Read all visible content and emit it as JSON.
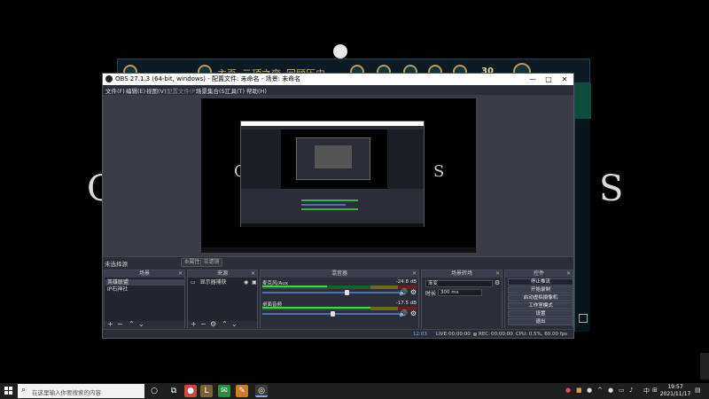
{
  "background": {
    "letter_left": "C",
    "letter_right": "S",
    "game_tabs": [
      "主页",
      "云顶之弈",
      "回顾历史"
    ],
    "game_number": "30"
  },
  "obs": {
    "title": "OBS 27.1.3 (64-bit, windows) - 配置文件: 未命名 - 场景: 未命名",
    "window_buttons": [
      "—",
      "□",
      "✕"
    ],
    "menu": [
      "文件(F)",
      "编辑(E)",
      "视图(V)",
      "配置文件(P)",
      "场景集合(S)",
      "工具(T)",
      "帮助(H)"
    ],
    "preview": {
      "letter_left": "C",
      "letter_right": "S"
    },
    "scene_bar": {
      "source_name": "未选择源",
      "properties_button": "⚙属性",
      "filters_button": "☰滤镜"
    },
    "scenes": {
      "title": "场景",
      "items": [
        "英雄联盟",
        "IP石神社"
      ]
    },
    "sources": {
      "title": "来源",
      "items": [
        "显示器捕获"
      ]
    },
    "mixer": {
      "title": "混音器",
      "channels": [
        {
          "name": "麦克风/Aux",
          "db": "-24.8 dB",
          "level": 0.42,
          "volume": 0.6
        },
        {
          "name": "桌面音频",
          "db": "-17.5 dB",
          "level": 0.7,
          "volume": 0.5
        }
      ]
    },
    "transitions": {
      "title": "场景转场",
      "type_value": "渐变",
      "duration_label": "时长",
      "duration_value": "300 ms"
    },
    "controls": {
      "title": "控件",
      "buttons": [
        "停止推流",
        "开始录制",
        "启动虚拟摄像机",
        "工作室模式",
        "设置",
        "退出"
      ]
    },
    "status": {
      "live_label": "LIVE:",
      "live_time": "00:00:00",
      "live_prefix": "12:03",
      "rec_label": "REC:",
      "rec_time": "00:00:00",
      "cpu": "CPU: 0.5%, 60.00 fps"
    }
  },
  "taskbar": {
    "search_placeholder": "在这里输入你要搜索的内容",
    "clock_time": "19:57",
    "clock_date": "2021/11/17",
    "lang": "中"
  }
}
